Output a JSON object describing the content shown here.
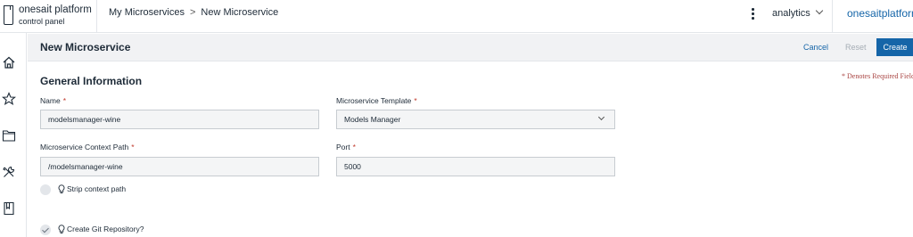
{
  "topbar": {
    "logo_line1": "onesait platform",
    "logo_line2": "control panel",
    "breadcrumb": [
      "My Microservices",
      "New Microservice"
    ],
    "breadcrumb_sep": ">",
    "user": "analytics",
    "brand": "onesaitplatform"
  },
  "sidebar": {
    "icons": [
      "home-icon",
      "star-icon",
      "folder-icon",
      "tools-icon",
      "book-icon"
    ]
  },
  "header": {
    "title": "New Microservice",
    "cancel_label": "Cancel",
    "reset_label": "Reset",
    "create_label": "Create"
  },
  "form": {
    "section_title": "General Information",
    "required_note": "* Denotes Required Field",
    "required_marker": "*",
    "name": {
      "label": "Name",
      "value": "modelsmanager-wine"
    },
    "template": {
      "label": "Microservice Template",
      "value": "Models Manager"
    },
    "context_path": {
      "label": "Microservice Context Path",
      "value": "/modelsmanager-wine"
    },
    "port": {
      "label": "Port",
      "value": "5000"
    },
    "strip_context": {
      "label": "Strip context path",
      "checked": false
    },
    "git_repo": {
      "label": "Create Git Repository?",
      "checked": true
    }
  },
  "colors": {
    "accent": "#1565a8",
    "required": "#c0392b",
    "header_bg": "#f1f2f4"
  }
}
